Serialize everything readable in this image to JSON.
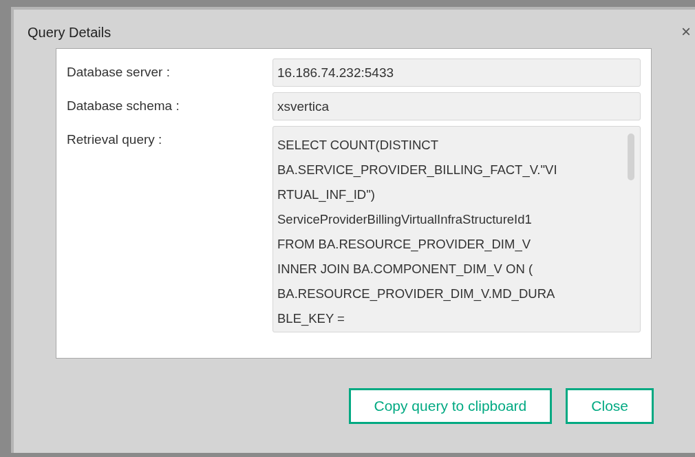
{
  "dialog": {
    "title": "Query Details",
    "close_icon": "×"
  },
  "fields": [
    {
      "kind": "single",
      "label": "Database server :",
      "value": "16.186.74.232:5433"
    },
    {
      "kind": "single",
      "label": "Database schema :",
      "value": "xsvertica"
    },
    {
      "kind": "multi",
      "label": "Retrieval query :",
      "value": "SELECT COUNT(DISTINCT\nBA.SERVICE_PROVIDER_BILLING_FACT_V.\"VI\nRTUAL_INF_ID\")\nServiceProviderBillingVirtualInfraStructureId1\nFROM BA.RESOURCE_PROVIDER_DIM_V\nINNER JOIN BA.COMPONENT_DIM_V ON (\nBA.RESOURCE_PROVIDER_DIM_V.MD_DURA\nBLE_KEY ="
    }
  ],
  "buttons": [
    "Copy query to clipboard",
    "Close"
  ]
}
